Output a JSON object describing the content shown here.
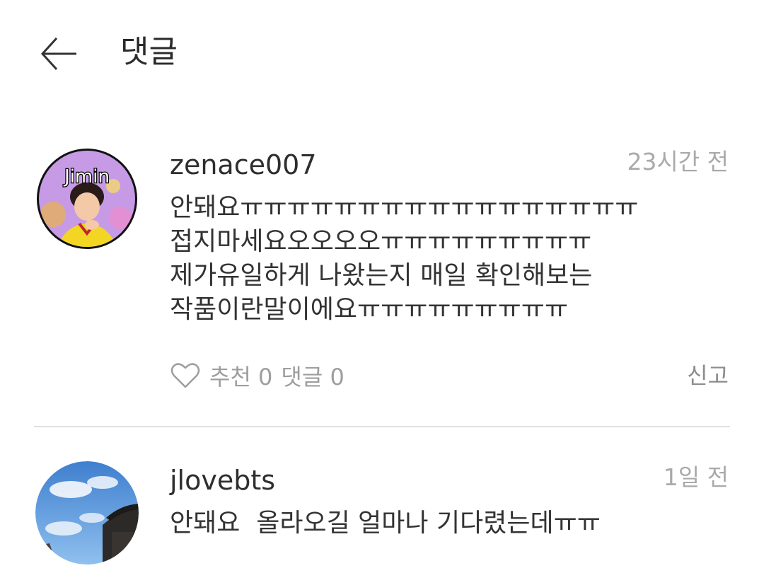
{
  "header": {
    "title": "댓글",
    "back_icon": "arrow-left-icon"
  },
  "comments": [
    {
      "username": "zenace007",
      "time": "23시간 전",
      "avatar_text": "Jimin",
      "lines": [
        "안돼요ㅠㅠㅠㅠㅠㅠㅠㅠㅠㅠㅠㅠㅠㅠㅠㅠㅠ",
        "접지마세요오오오오ㅠㅠㅠㅠㅠㅠㅠㅠㅠ",
        "제가유일하게 나왔는지 매일 확인해보는",
        "작품이란말이에요ㅠㅠㅠㅠㅠㅠㅠㅠㅠ"
      ],
      "like_label": "추천 0",
      "reply_label": "댓글 0",
      "report_label": "신고"
    },
    {
      "username": "jlovebts",
      "time": "1일 전",
      "lines": [
        "안돼요  올라오길 얼마나 기다렸는데ㅠㅠ"
      ]
    }
  ],
  "colors": {
    "text": "#333333",
    "muted": "#9e9e9e",
    "divider": "#e0e0e0",
    "avatar_border": "#111111",
    "avatar_bg": "#c79ae6"
  }
}
